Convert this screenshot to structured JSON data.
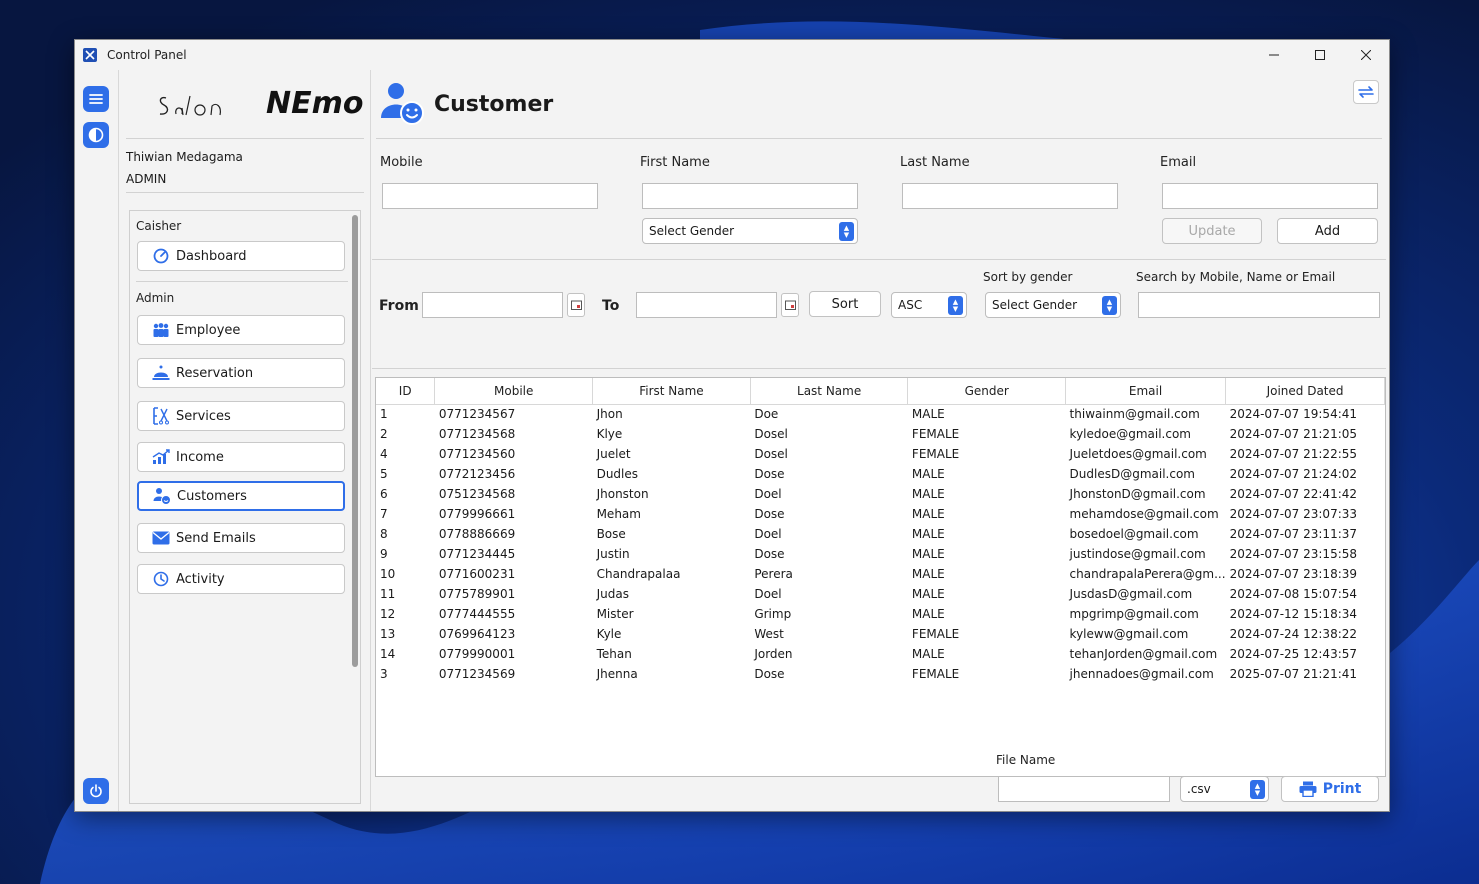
{
  "window": {
    "title": "Control Panel"
  },
  "brand": {
    "script": "Salon",
    "bold": "NEmo"
  },
  "user": {
    "name": "Thiwian Medagama",
    "role": "ADMIN"
  },
  "nav": {
    "group1": "Caisher",
    "group2": "Admin",
    "items": [
      {
        "label": "Dashboard",
        "icon": "gauge-icon"
      },
      {
        "label": "Employee",
        "icon": "employee-icon"
      },
      {
        "label": "Reservation",
        "icon": "bell-icon"
      },
      {
        "label": "Services",
        "icon": "services-icon"
      },
      {
        "label": "Income",
        "icon": "chart-icon"
      },
      {
        "label": "Customers",
        "icon": "customers-icon"
      },
      {
        "label": "Send Emails",
        "icon": "mail-icon"
      },
      {
        "label": "Activity",
        "icon": "clock-icon"
      }
    ]
  },
  "page": {
    "title": "Customer"
  },
  "form": {
    "mobile_label": "Mobile",
    "first_name_label": "First Name",
    "last_name_label": "Last Name",
    "email_label": "Email",
    "gender_select": "Select Gender",
    "update_label": "Update",
    "add_label": "Add"
  },
  "filter": {
    "from_label": "From",
    "to_label": "To",
    "sort_label": "Sort",
    "order_value": "ASC",
    "sort_by_gender_label": "Sort by gender",
    "gender_select": "Select Gender",
    "search_label": "Search by Mobile, Name or Email"
  },
  "table": {
    "columns": [
      "ID",
      "Mobile",
      "First Name",
      "Last Name",
      "Gender",
      "Email",
      "Joined Dated"
    ],
    "rows": [
      [
        "1",
        "0771234567",
        "Jhon",
        "Doe",
        "MALE",
        "thiwainm@gmail.com",
        "2024-07-07 19:54:41"
      ],
      [
        "2",
        "0771234568",
        "Klye",
        "Dosel",
        "FEMALE",
        "kyledoe@gmail.com",
        "2024-07-07 21:21:05"
      ],
      [
        "4",
        "0771234560",
        "Juelet",
        "Dosel",
        "FEMALE",
        "Jueletdoes@gmail.com",
        "2024-07-07 21:22:55"
      ],
      [
        "5",
        "0772123456",
        "Dudles",
        "Dose",
        "MALE",
        "DudlesD@gmail.com",
        "2024-07-07 21:24:02"
      ],
      [
        "6",
        "0751234568",
        "Jhonston",
        "Doel",
        "MALE",
        "JhonstonD@gmail.com",
        "2024-07-07 22:41:42"
      ],
      [
        "7",
        "0779996661",
        "Meham",
        "Dose",
        "MALE",
        "mehamdose@gmail.com",
        "2024-07-07 23:07:33"
      ],
      [
        "8",
        "0778886669",
        "Bose",
        "Doel",
        "MALE",
        "bosedoel@gmail.com",
        "2024-07-07 23:11:37"
      ],
      [
        "9",
        "0771234445",
        "Justin",
        "Dose",
        "MALE",
        "justindose@gmail.com",
        "2024-07-07 23:15:58"
      ],
      [
        "10",
        "0771600231",
        "Chandrapalaa",
        "Perera",
        "MALE",
        "chandrapalaPerera@gm...",
        "2024-07-07 23:18:39"
      ],
      [
        "11",
        "0775789901",
        "Judas",
        "Doel",
        "MALE",
        "JusdasD@gmail.com",
        "2024-07-08 15:07:54"
      ],
      [
        "12",
        "0777444555",
        "Mister",
        "Grimp",
        "MALE",
        "mpgrimp@gmail.com",
        "2024-07-12 15:18:34"
      ],
      [
        "13",
        "0769964123",
        "Kyle",
        "West",
        "FEMALE",
        "kyleww@gmail.com",
        "2024-07-24 12:38:22"
      ],
      [
        "14",
        "0779990001",
        "Tehan",
        "Jorden",
        "MALE",
        "tehanJorden@gmail.com",
        "2024-07-25 12:43:57"
      ],
      [
        "3",
        "0771234569",
        "Jhenna",
        "Dose",
        "FEMALE",
        "jhennadoes@gmail.com",
        "2025-07-07 21:21:41"
      ]
    ]
  },
  "export": {
    "file_name_label": "File Name",
    "format_value": ".csv",
    "print_label": "Print"
  },
  "colors": {
    "accent": "#2f6ee8"
  }
}
